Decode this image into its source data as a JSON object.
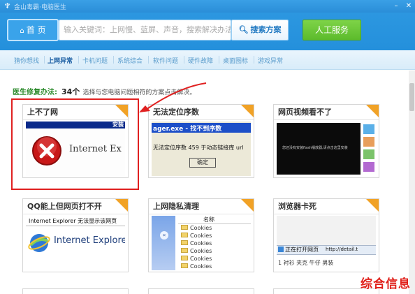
{
  "titlebar": {
    "title": "金山毒霸·电脑医生"
  },
  "header": {
    "home_label": "首 页",
    "search_placeholder": "输入关键词：上网慢、蓝屏、声音，搜索解决办法",
    "search_button": "搜索方案",
    "service_button": "人工服务"
  },
  "nav": {
    "items": [
      {
        "label": "猜你想找"
      },
      {
        "label": "上网异常"
      },
      {
        "label": "卡机问题"
      },
      {
        "label": "系统综合"
      },
      {
        "label": "软件问题"
      },
      {
        "label": "硬件故障"
      },
      {
        "label": "桌面图标"
      },
      {
        "label": "游戏异常"
      }
    ],
    "active_index": 1
  },
  "summary": {
    "label": "医生修复办法:",
    "count": "34个",
    "text": "选择与您电脑问题相符的方案点击解决。"
  },
  "cards": [
    {
      "title": "上不了网",
      "screen_bar": "安装",
      "screen_text": "Internet Ex"
    },
    {
      "title": "无法定位序数",
      "screen_bar": "ager.exe - 找不到序数",
      "screen_text": "无法定位序数 459 于动态链接库 url",
      "button": "确定"
    },
    {
      "title": "网页视频看不了",
      "screen_text": "您还没有安装flash播放器,请点击这里安装"
    },
    {
      "title": "QQ能上但网页打不开",
      "screen_bar": "Internet Explorer 无法显示该网页",
      "screen_text": "Internet Explore"
    },
    {
      "title": "上网隐私清理",
      "column": "名称",
      "files": [
        "Cookies",
        "Cookies",
        "Cookies",
        "Cookies",
        "Cookies",
        "Cookies"
      ]
    },
    {
      "title": "浏览器卡死",
      "status": "正在打开网页",
      "url": "http://detail.t",
      "links": "1 衬衫 夹克 牛仔 男装"
    }
  ],
  "watermark": "综合信息",
  "colors": {
    "brand_blue": "#2a8ed8",
    "accent_green": "#5cbb2c",
    "highlight_red": "#e02020",
    "badge_orange": "#f1a226"
  }
}
